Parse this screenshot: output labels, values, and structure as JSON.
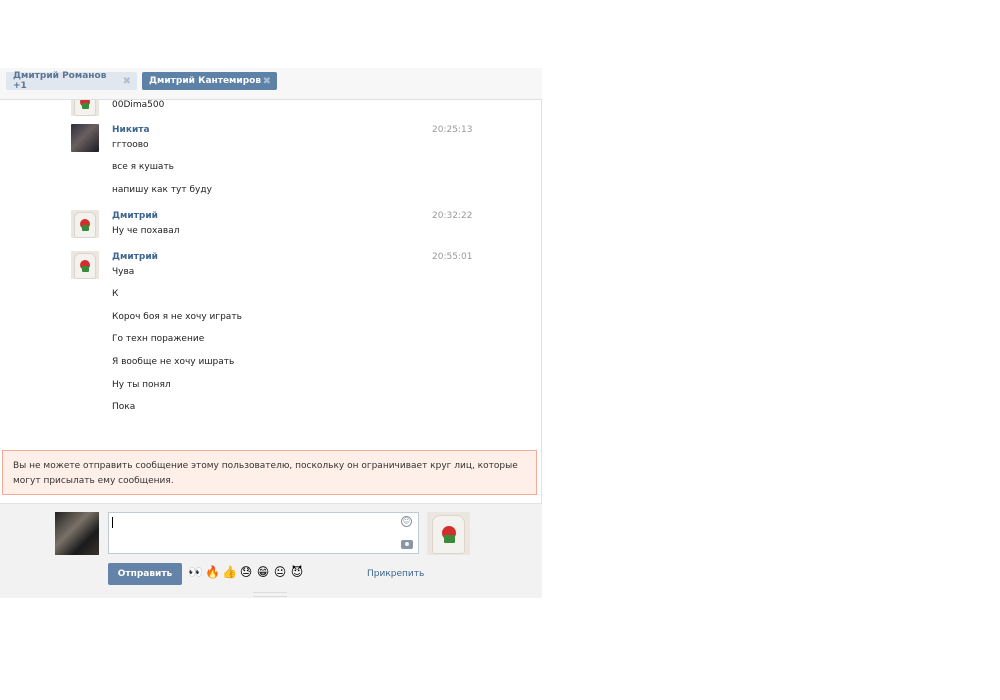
{
  "tabs": [
    {
      "label": "Дмитрий Романов +1",
      "close": "✖"
    },
    {
      "label": "Дмитрий Кантемиров",
      "close": "✖"
    }
  ],
  "history": {
    "partial_message": "00Dima500",
    "groups": [
      {
        "author": "Никита",
        "time": "20:25:13",
        "messages": [
          "ггтоово",
          "все я кушать",
          "напишу как тут буду"
        ]
      },
      {
        "author": "Дмитрий",
        "time": "20:32:22",
        "messages": [
          "Ну че похавал"
        ]
      },
      {
        "author": "Дмитрий",
        "time": "20:55:01",
        "messages": [
          "Чува",
          "К",
          "Короч боя я не хочу играть",
          "Го техн поражение",
          "Я вообще не хочу ишрать",
          "Ну ты понял",
          "Пока"
        ]
      }
    ]
  },
  "error": {
    "text": "Вы не можете отправить сообщение этому пользователю, поскольку он ограничивает круг лиц, которые могут присылать ему сообщения."
  },
  "composer": {
    "send_label": "Отправить",
    "attach_label": "Прикрепить",
    "emojis": [
      "👀",
      "🔥",
      "👍",
      "😓",
      "😁",
      "😐",
      "😈"
    ]
  }
}
